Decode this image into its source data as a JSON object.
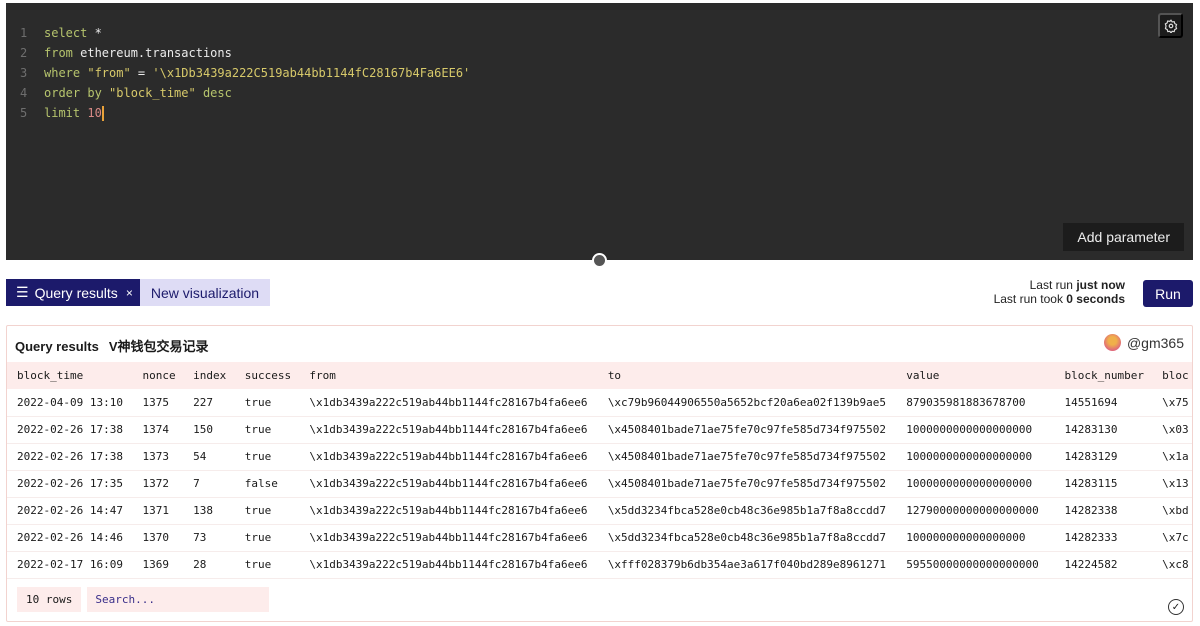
{
  "editor": {
    "lines": [
      [
        {
          "t": "select",
          "c": "kw"
        },
        {
          "t": " *",
          "c": "id"
        }
      ],
      [
        {
          "t": "from",
          "c": "kw"
        },
        {
          "t": " ethereum.transactions",
          "c": "id"
        }
      ],
      [
        {
          "t": "where",
          "c": "kw"
        },
        {
          "t": " \"from\"",
          "c": "str"
        },
        {
          "t": " = ",
          "c": "id"
        },
        {
          "t": "'\\x1Db3439a222C519ab44bb1144fC28167b4Fa6EE6'",
          "c": "str"
        }
      ],
      [
        {
          "t": "order by",
          "c": "kw"
        },
        {
          "t": " \"block_time\"",
          "c": "str"
        },
        {
          "t": " desc",
          "c": "kw"
        }
      ],
      [
        {
          "t": "limit",
          "c": "kw"
        },
        {
          "t": " 10",
          "c": "num"
        }
      ]
    ],
    "add_parameter": "Add parameter",
    "settings_icon": "gear-icon"
  },
  "tabs": [
    {
      "label": "Query results",
      "icon": "list-icon",
      "close": "×"
    },
    {
      "label": "New visualization"
    }
  ],
  "run": {
    "last_run_prefix": "Last run ",
    "last_run": "just now",
    "took_prefix": "Last run took ",
    "took": "0 seconds",
    "button": "Run"
  },
  "results": {
    "title": "Query results",
    "query_name": "V神钱包交易记录",
    "user": "@gm365",
    "columns": [
      "block_time",
      "nonce",
      "index",
      "success",
      "from",
      "to",
      "value",
      "block_number",
      "bloc"
    ],
    "rows": [
      [
        "2022-04-09 13:10",
        "1375",
        "227",
        "true",
        "\\x1db3439a222c519ab44bb1144fc28167b4fa6ee6",
        "\\xc79b96044906550a5652bcf20a6ea02f139b9ae5",
        "879035981883678700",
        "14551694",
        "\\x75"
      ],
      [
        "2022-02-26 17:38",
        "1374",
        "150",
        "true",
        "\\x1db3439a222c519ab44bb1144fc28167b4fa6ee6",
        "\\x4508401bade71ae75fe70c97fe585d734f975502",
        "1000000000000000000",
        "14283130",
        "\\x03"
      ],
      [
        "2022-02-26 17:38",
        "1373",
        "54",
        "true",
        "\\x1db3439a222c519ab44bb1144fc28167b4fa6ee6",
        "\\x4508401bade71ae75fe70c97fe585d734f975502",
        "1000000000000000000",
        "14283129",
        "\\x1a"
      ],
      [
        "2022-02-26 17:35",
        "1372",
        "7",
        "false",
        "\\x1db3439a222c519ab44bb1144fc28167b4fa6ee6",
        "\\x4508401bade71ae75fe70c97fe585d734f975502",
        "1000000000000000000",
        "14283115",
        "\\x13"
      ],
      [
        "2022-02-26 14:47",
        "1371",
        "138",
        "true",
        "\\x1db3439a222c519ab44bb1144fc28167b4fa6ee6",
        "\\x5dd3234fbca528e0cb48c36e985b1a7f8a8ccdd7",
        "12790000000000000000",
        "14282338",
        "\\xbd"
      ],
      [
        "2022-02-26 14:46",
        "1370",
        "73",
        "true",
        "\\x1db3439a222c519ab44bb1144fc28167b4fa6ee6",
        "\\x5dd3234fbca528e0cb48c36e985b1a7f8a8ccdd7",
        "100000000000000000",
        "14282333",
        "\\x7c"
      ],
      [
        "2022-02-17 16:09",
        "1369",
        "28",
        "true",
        "\\x1db3439a222c519ab44bb1144fc28167b4fa6ee6",
        "\\xfff028379b6db354ae3a617f040bd289e8961271",
        "59550000000000000000",
        "14224582",
        "\\xc8"
      ]
    ],
    "row_count": "10 rows",
    "search_placeholder": "Search..."
  },
  "colors": {
    "accent": "#1c1a6b",
    "editor_bg": "#2b2b2b",
    "header_bg": "#fdeceb"
  }
}
